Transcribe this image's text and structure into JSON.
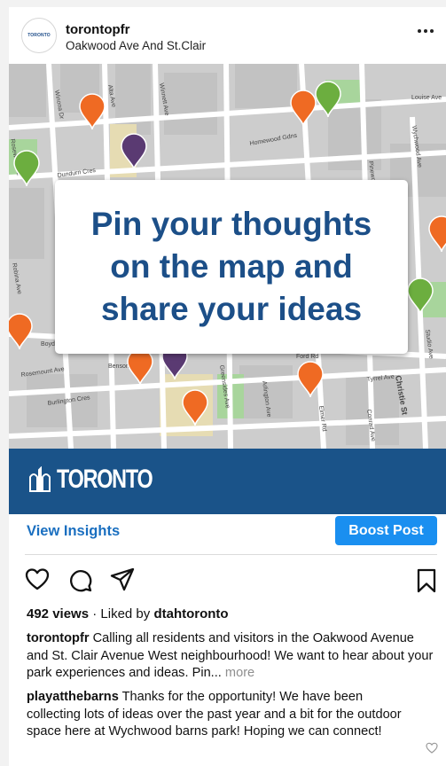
{
  "post": {
    "username": "torontopfr",
    "location": "Oakwood Ave And St.Clair",
    "avatar_text": "TORONTO"
  },
  "image": {
    "headline_lines": [
      "Pin your thoughts",
      "on the map and",
      "share your ideas"
    ],
    "brand": "TORONTO",
    "street_labels": [
      "Winona Dr",
      "Alta Ave",
      "Winnett Ave",
      "Louise Ave",
      "Homewood Gdns",
      "Wychwood Ave",
      "Dundurn Cres",
      "Rosewell Ave",
      "Robina Ave",
      "Boyd",
      "Rosemount Ave",
      "Burlington Cres",
      "Benson",
      "Greensides Ave",
      "Ford Rd",
      "Arlington Ave",
      "Tyrrel Ave",
      "Christie St",
      "Conrad Ave",
      "Elmer Rd",
      "Pinewood",
      "Studio Ave"
    ],
    "colors": {
      "orange_pin": "#ef6a23",
      "green_pin": "#6cae3f",
      "purple_pin": "#5a3a72",
      "brand_blue": "#1a5389",
      "headline": "#1c4f88"
    }
  },
  "actions": {
    "insights_label": "View Insights",
    "boost_label": "Boost Post",
    "icons": [
      "heart-icon",
      "comment-icon",
      "send-icon",
      "bookmark-icon"
    ]
  },
  "stats": {
    "views": "492 views",
    "separator": "·",
    "liked_prefix": "Liked by",
    "liked_user": "dtahtoronto"
  },
  "caption": {
    "username": "torontopfr",
    "text": "Calling all residents and visitors in the Oakwood Avenue and St. Clair Avenue West neighbourhood! We want to hear about your park experiences and ideas. Pin...",
    "more_label": "more"
  },
  "comment": {
    "username": "playatthebarns",
    "text": "Thanks for the opportunity! We have been collecting lots of ideas over the past year and a bit for the outdoor space here at Wychwood  barns park! Hoping we can connect!"
  }
}
